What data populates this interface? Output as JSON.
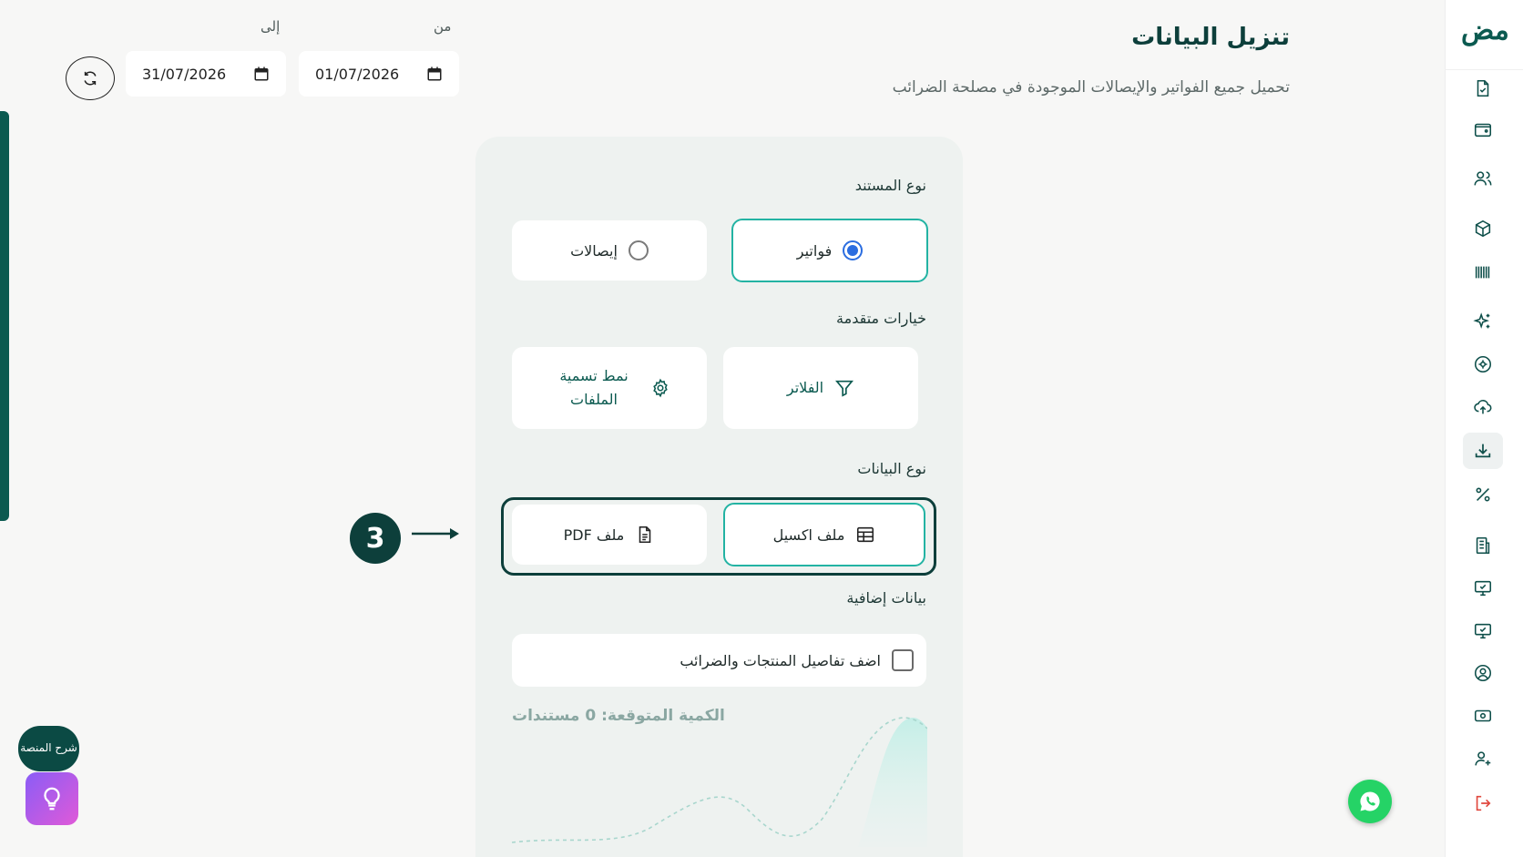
{
  "header": {
    "title": "تنزيل البيانات",
    "subtitle": "تحميل جميع الفواتير والإيصالات الموجودة في مصلحة الضرائب"
  },
  "date_range": {
    "from_label": "من",
    "from_value": "01/07/2026",
    "to_label": "إلى",
    "to_value": "31/07/2026"
  },
  "brand": {
    "logo_text": "مض",
    "accent": "#0b5a50",
    "selected_border": "#23b3a3",
    "radio": "#2b6de0"
  },
  "form": {
    "document_type_label": "نوع المستند",
    "document_types": [
      "فواتير",
      "إيصالات"
    ],
    "selected_document_type": "فواتير",
    "advanced_label": "خيارات متقدمة",
    "filters_label": "الفلاتر",
    "naming_label": "نمط تسمية الملفات",
    "data_type_label": "نوع البيانات",
    "excel_label": "ملف اكسيل",
    "pdf_label": "ملف PDF",
    "selected_data_type": "ملف اكسيل",
    "extra_label": "بيانات إضافية",
    "extra_checkbox_label": "اضف تفاصيل المنتجات والضرائب",
    "expected_count": "الكمية المتوقعة: 0 مستندات"
  },
  "step_marker": "3",
  "help": {
    "label": "شرح المنصة"
  },
  "sidebar": {
    "icons": [
      "document-icon",
      "wallet-icon",
      "users-icon",
      "box-icon",
      "barcode-icon",
      "sparkle-icon",
      "settings-icon",
      "upload-icon",
      "download-icon",
      "percent-icon",
      "building-icon",
      "monitor-check-icon",
      "monitor-check-icon",
      "user-circle-icon",
      "cash-icon",
      "user-add-icon",
      "logout-icon"
    ],
    "active": "download-icon"
  }
}
